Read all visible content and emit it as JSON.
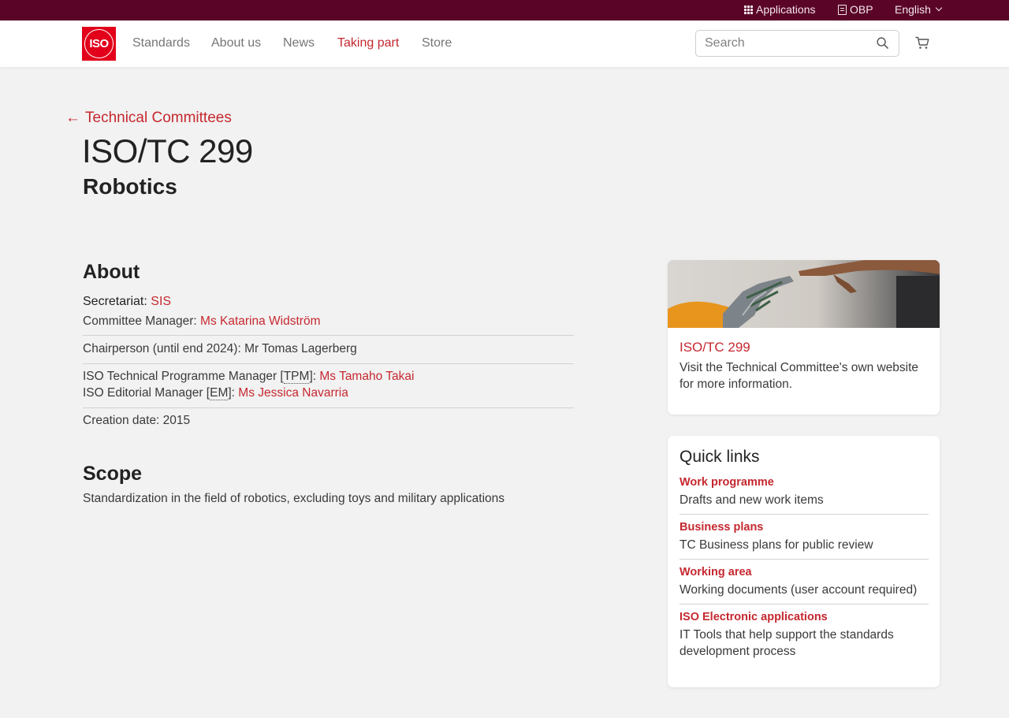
{
  "topbar": {
    "applications_label": "Applications",
    "obp_label": "OBP",
    "language_label": "English"
  },
  "header": {
    "logo_text": "ISO",
    "nav": [
      {
        "label": "Standards"
      },
      {
        "label": "About us"
      },
      {
        "label": "News"
      },
      {
        "label": "Taking part",
        "active": true
      },
      {
        "label": "Store"
      }
    ],
    "search_placeholder": "Search"
  },
  "page": {
    "back_link": "Technical Committees",
    "title": "ISO/TC 299",
    "subtitle": "Robotics"
  },
  "about": {
    "heading": "About",
    "secretariat_label": "Secretariat:",
    "secretariat_value": "SIS",
    "committee_manager_label": "Committee Manager:",
    "committee_manager_value": "Ms Katarina Widström",
    "chairperson_text": "Chairperson (until end 2024): Mr Tomas Lagerberg",
    "tpm_prefix": "ISO Technical Programme Manager [",
    "tpm_abbr": "TPM",
    "tpm_suffix": "]:",
    "tpm_value": "Ms Tamaho Takai",
    "em_prefix": "ISO Editorial Manager [",
    "em_abbr": "EM",
    "em_suffix": "]:",
    "em_value": "Ms Jessica Navarria",
    "creation_text": "Creation date: 2015"
  },
  "scope": {
    "heading": "Scope",
    "text": "Standardization in the field of robotics, excluding toys and military applications"
  },
  "tc_card": {
    "title": "ISO/TC 299",
    "text": "Visit the Technical Committee's own website for more information."
  },
  "quick_links": {
    "heading": "Quick links",
    "items": [
      {
        "label": "Work programme",
        "description": "Drafts and new work items"
      },
      {
        "label": "Business plans",
        "description": "TC Business plans for public review"
      },
      {
        "label": "Working area",
        "description": "Working documents (user account required)"
      },
      {
        "label": "ISO Electronic applications",
        "description": "IT Tools that help support the standards development process"
      }
    ]
  },
  "colors": {
    "topbar": "#5a0427",
    "accent": "#c5282f",
    "logo_red": "#e2001a",
    "background": "#f2f2f2"
  }
}
